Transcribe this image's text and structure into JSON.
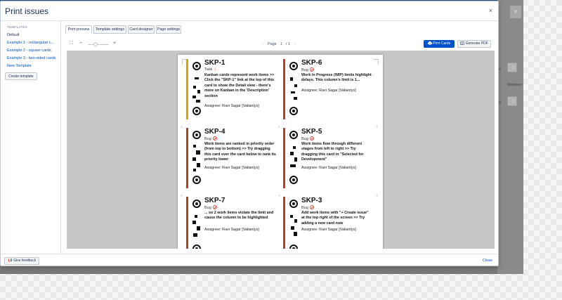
{
  "colors": {
    "accent": "#0052cc",
    "task_bar": "#d4a900",
    "bug_bar": "#b3402e",
    "overlay": "#7a7a7a",
    "preview_bg": "#c7c7c7"
  },
  "background": {
    "close_glyph": "×",
    "row_text_1": "ile",
    "row_text_2": "Releases",
    "row_text_3": "ile"
  },
  "modal": {
    "title": "Print issues",
    "close_glyph": "×"
  },
  "sidebar": {
    "heading": "TEMPLATES",
    "items": [
      {
        "label": "Default",
        "active": true
      },
      {
        "label": "Example 1 - rectangular c...",
        "active": false
      },
      {
        "label": "Example 2 - square cards",
        "active": false
      },
      {
        "label": "Example 3 - two-sided cards",
        "active": false
      },
      {
        "label": "New Template",
        "active": false
      }
    ],
    "create_label": "Create template"
  },
  "tabs": [
    {
      "label": "Print preview",
      "active": true
    },
    {
      "label": "Template settings",
      "active": false
    },
    {
      "label": "Card designer",
      "active": false
    },
    {
      "label": "Page settings",
      "active": false
    }
  ],
  "toolbar": {
    "fullscreen_icon": "⛶",
    "zoom_out": "−",
    "zoom_in": "+",
    "zoom_level": 0.5,
    "page_prev": "‹",
    "page_label": "Page",
    "page_value": "1",
    "page_sep": "/",
    "page_total": "1",
    "page_next": "›",
    "print_label": "Print Cards",
    "print_icon": "printer-icon",
    "pdf_label": "Generate PDF",
    "pdf_icon": "pdf-icon"
  },
  "cards": [
    {
      "key": "SKP-1",
      "type": "Task",
      "type_icon": "task-icon",
      "summary": "Kanban cards represent work items >> Click the \"SKP-1\" link at the top of this card to show the Detail view - there's more on Kanban in the 'Description' section",
      "assignee": "Assignee: Ravi Sagar [Valiantys]"
    },
    {
      "key": "SKP-6",
      "type": "Bug",
      "type_icon": "bug-icon",
      "summary": "Work in Progress (WIP) limits highlight delays. This column's limit is 1...",
      "assignee": "Assignee: Ravi Sagar [Valiantys]"
    },
    {
      "key": "SKP-4",
      "type": "Bug",
      "type_icon": "bug-icon",
      "summary": "Work items are ranked in priority order (from top to bottom) >> Try dragging this card over the card below to rank its priority lower",
      "assignee": "Assignee: Ravi Sagar [Valiantys]"
    },
    {
      "key": "SKP-5",
      "type": "Bug",
      "type_icon": "bug-icon",
      "summary": "Work items flow through different stages from left to right >> Try dragging this card to \"Selected for Development\"",
      "assignee": "Assignee: Ravi Sagar [Valiantys]"
    },
    {
      "key": "SKP-7",
      "type": "Bug",
      "type_icon": "bug-icon",
      "summary": "... so 2 work items violate the limit and cause the column to be highlighted",
      "assignee": "Assignee: Ravi Sagar [Valiantys]"
    },
    {
      "key": "SKP-3",
      "type": "Bug",
      "type_icon": "bug-icon",
      "summary": "Add work items with \"+ Create issue\" at the top right of the screen >> Try adding a new card now",
      "assignee": "Assignee: Ravi Sagar [Valiantys]"
    }
  ],
  "footer": {
    "feedback_label": "Give feedback",
    "feedback_icon": "megaphone-icon",
    "close_label": "Close"
  }
}
